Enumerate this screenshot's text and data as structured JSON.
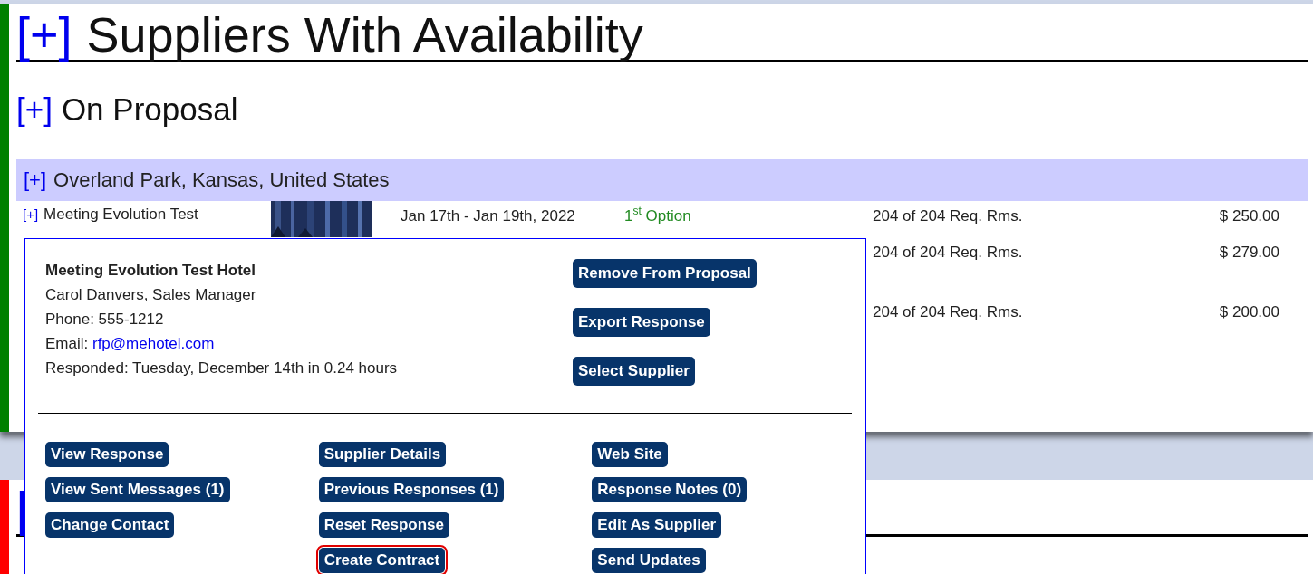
{
  "page_title": {
    "toggle": "[+]",
    "text": "Suppliers With Availability"
  },
  "section": {
    "toggle": "[+]",
    "title": "On Proposal"
  },
  "location": {
    "toggle": "[+]",
    "name": "Overland Park, Kansas, United States"
  },
  "rows": [
    {
      "toggle": "[+]",
      "name": "Meeting Evolution Test",
      "dates": "Jan 17th - Jan 19th, 2022",
      "option": "1$^{st}$ Option",
      "rooms": "204 of 204 Req. Rms.",
      "rate": "$ 250.00"
    },
    {
      "rooms": "204 of 204 Req. Rms.",
      "rate": "$ 279.00"
    },
    {
      "rooms": "204 of 204 Req. Rms.",
      "rate": "$ 200.00"
    }
  ],
  "popup": {
    "hotel": "Meeting Evolution Test Hotel",
    "contact": "Carol Danvers, Sales Manager",
    "phone": "Phone: 555-1212",
    "email_label": "Email:",
    "email": "rfp@mehotel.com",
    "responded": "Responded: Tuesday, December 14th in 0.24 hours",
    "primary_actions": [
      "Remove From Proposal",
      "Export Response",
      "Select Supplier"
    ],
    "action_columns": [
      [
        {
          "label": "View Response",
          "highlighted": false
        },
        {
          "label": "View Sent Messages (1)",
          "highlighted": false
        },
        {
          "label": "Change Contact",
          "highlighted": false
        }
      ],
      [
        {
          "label": "Supplier Details",
          "highlighted": false
        },
        {
          "label": "Previous Responses (1)",
          "highlighted": false
        },
        {
          "label": "Reset Response",
          "highlighted": false
        },
        {
          "label": "Create Contract",
          "highlighted": true
        }
      ],
      [
        {
          "label": "Web Site",
          "highlighted": false
        },
        {
          "label": "Response Notes (0)",
          "highlighted": false
        },
        {
          "label": "Edit As Supplier",
          "highlighted": false
        },
        {
          "label": "Send Updates",
          "highlighted": false
        }
      ]
    ]
  },
  "next_section": {
    "toggle": "["
  }
}
